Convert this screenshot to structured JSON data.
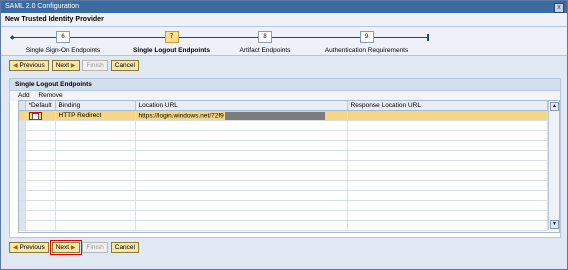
{
  "window": {
    "title": "SAML 2.0 Configuration",
    "close": "x"
  },
  "header": {
    "title": "New Trusted Identity Provider"
  },
  "roadmap": {
    "steps": [
      {
        "num": "6",
        "label": "Single Sign-On Endpoints",
        "active": false
      },
      {
        "num": "7",
        "label": "Single Logout Endpoints",
        "active": true
      },
      {
        "num": "8",
        "label": "Artifact Endpoints",
        "active": false
      },
      {
        "num": "9",
        "label": "Authentication Requirements",
        "active": false
      }
    ]
  },
  "nav": {
    "previous": "Previous",
    "next": "Next",
    "finish": "Finish",
    "cancel": "Cancel"
  },
  "panel": {
    "title": "Single Logout Endpoints",
    "toolbar": {
      "add": "Add",
      "remove": "Remove"
    },
    "columns": [
      "*Default",
      "Binding",
      "Location URL",
      "Response Location URL"
    ],
    "rows": [
      {
        "default": "",
        "binding": "HTTP Redirect",
        "location": "https://login.windows.net/72f9",
        "response": ""
      }
    ]
  },
  "colors": {
    "accent": "#3d6aa0",
    "selection": "#f4d684",
    "highlight": "#e00000"
  }
}
